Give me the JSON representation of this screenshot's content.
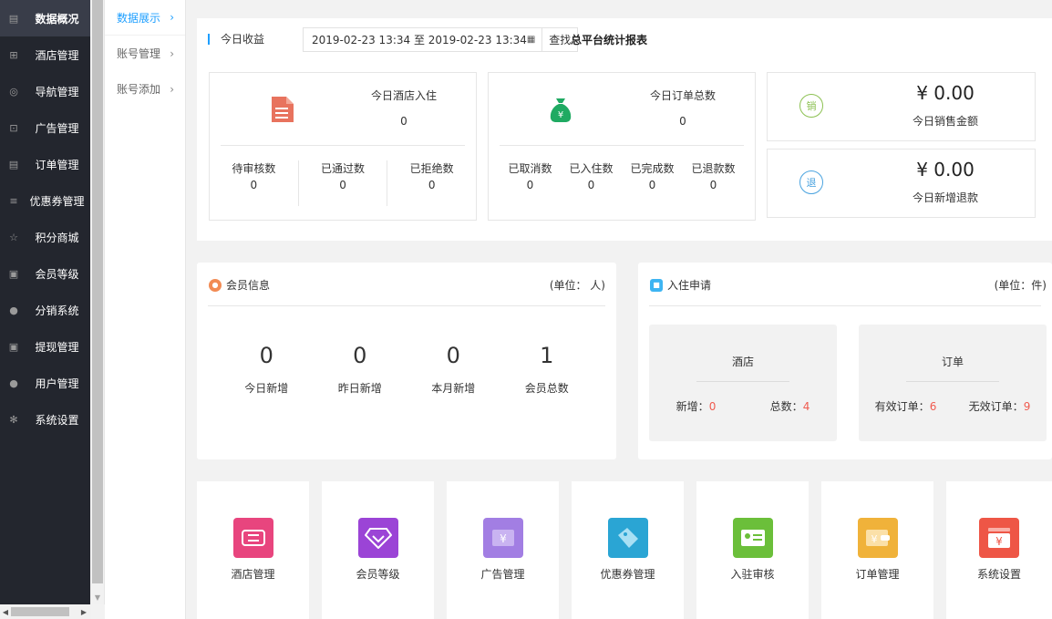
{
  "sidebar": {
    "items": [
      {
        "label": "数据概况",
        "icon": "dashboard-icon",
        "glyph": "▤"
      },
      {
        "label": "酒店管理",
        "icon": "cart-icon",
        "glyph": "⊞"
      },
      {
        "label": "导航管理",
        "icon": "compass-icon",
        "glyph": "◎"
      },
      {
        "label": "广告管理",
        "icon": "gift-icon",
        "glyph": "⊡"
      },
      {
        "label": "订单管理",
        "icon": "list-icon",
        "glyph": "▤"
      },
      {
        "label": "优惠券管理",
        "icon": "menu-icon",
        "glyph": "≡"
      },
      {
        "label": "积分商城",
        "icon": "star-icon",
        "glyph": "☆"
      },
      {
        "label": "会员等级",
        "icon": "money-icon",
        "glyph": "▣"
      },
      {
        "label": "分销系统",
        "icon": "users-icon",
        "glyph": "●"
      },
      {
        "label": "提现管理",
        "icon": "wallet-icon",
        "glyph": "▣"
      },
      {
        "label": "用户管理",
        "icon": "user-icon",
        "glyph": "●"
      },
      {
        "label": "系统设置",
        "icon": "gear-icon",
        "glyph": "✻"
      }
    ]
  },
  "submenu": {
    "items": [
      {
        "label": "数据展示",
        "chev": "›"
      },
      {
        "label": "账号管理",
        "chev": "›"
      },
      {
        "label": "账号添加",
        "chev": "›"
      }
    ]
  },
  "today": {
    "title": "今日收益",
    "date_range": "2019-02-23 13:34 至 2019-02-23 13:34",
    "search_label": "查找",
    "platform_title": "总平台统计报表",
    "hotel": {
      "label": "今日酒店入住",
      "value": "0",
      "subs": [
        {
          "label": "待审核数",
          "value": "0"
        },
        {
          "label": "已通过数",
          "value": "0"
        },
        {
          "label": "已拒绝数",
          "value": "0"
        }
      ]
    },
    "orders": {
      "label": "今日订单总数",
      "value": "0",
      "subs": [
        {
          "label": "已取消数",
          "value": "0"
        },
        {
          "label": "已入住数",
          "value": "0"
        },
        {
          "label": "已完成数",
          "value": "0"
        },
        {
          "label": "已退款数",
          "value": "0"
        }
      ]
    },
    "sales": {
      "icon_text": "销",
      "value": "¥ 0.00",
      "label": "今日销售金额",
      "color": "#8cc152"
    },
    "refund": {
      "icon_text": "退",
      "value": "¥ 0.00",
      "label": "今日新增退款",
      "color": "#4aa3df"
    }
  },
  "member": {
    "title": "会员信息",
    "unit": "(单位：  人)",
    "stats": [
      {
        "value": "0",
        "label": "今日新增"
      },
      {
        "value": "0",
        "label": "昨日新增"
      },
      {
        "value": "0",
        "label": "本月新增"
      },
      {
        "value": "1",
        "label": "会员总数"
      }
    ]
  },
  "checkin": {
    "title": "入住申请",
    "unit": "(单位：件)",
    "hotel": {
      "title": "酒店",
      "new_label": "新增：",
      "new_value": "0",
      "total_label": "总数：",
      "total_value": "4"
    },
    "order": {
      "title": "订单",
      "valid_label": "有效订单：",
      "valid_value": "6",
      "invalid_label": "无效订单：",
      "invalid_value": "9"
    }
  },
  "tiles": [
    {
      "label": "酒店管理",
      "color": "#e8457e"
    },
    {
      "label": "会员等级",
      "color": "#9b44d6"
    },
    {
      "label": "广告管理",
      "color": "#a27ee3"
    },
    {
      "label": "优惠券管理",
      "color": "#2aa5d4"
    },
    {
      "label": "入驻审核",
      "color": "#6bbf3a"
    },
    {
      "label": "订单管理",
      "color": "#f0b23a"
    },
    {
      "label": "系统设置",
      "color": "#ee5646"
    }
  ]
}
